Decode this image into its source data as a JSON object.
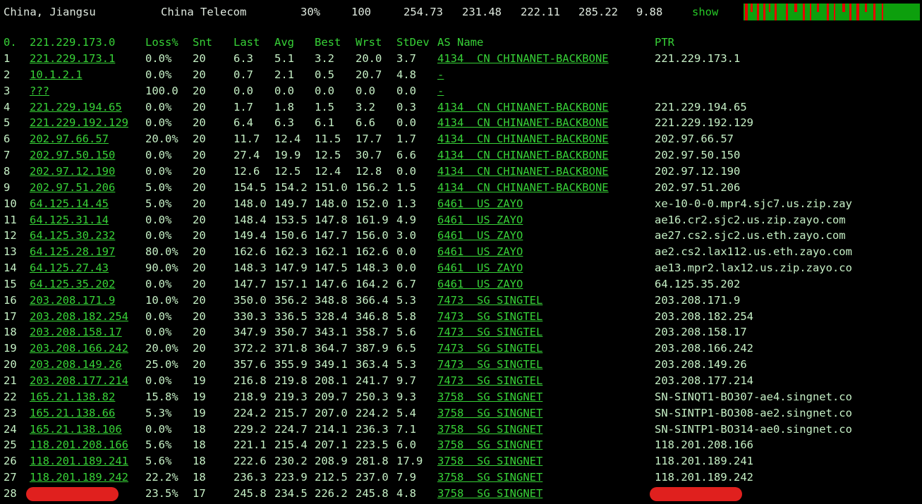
{
  "header": {
    "location": "China, Jiangsu",
    "isp": "China Telecom",
    "loss": "30%",
    "sent": "100",
    "v1": "254.73",
    "v2": "231.48",
    "v3": "222.11",
    "v4": "285.22",
    "v5": "9.88",
    "show_label": "show",
    "bar_colors": {
      "ok": "#0d9f0d",
      "loss": "#e60000"
    }
  },
  "columns": {
    "hop": "0.",
    "ip": "221.229.173.0",
    "loss": "Loss%",
    "snt": "Snt",
    "last": "Last",
    "avg": "Avg",
    "best": "Best",
    "wrst": "Wrst",
    "stdev": "StDev",
    "as": "AS Name",
    "ptr": "PTR"
  },
  "rows": [
    {
      "hop": "1",
      "ip": "221.229.173.1",
      "loss": "0.0%",
      "snt": "20",
      "last": "6.3",
      "avg": "5.1",
      "best": "3.2",
      "wrst": "20.0",
      "std": "3.7",
      "as": "4134  CN CHINANET-BACKBONE",
      "ptr": "221.229.173.1"
    },
    {
      "hop": "2",
      "ip": "10.1.2.1",
      "loss": "0.0%",
      "snt": "20",
      "last": "0.7",
      "avg": "2.1",
      "best": "0.5",
      "wrst": "20.7",
      "std": "4.8",
      "as": "-",
      "ptr": ""
    },
    {
      "hop": "3",
      "ip": "???",
      "loss": "100.0",
      "snt": "20",
      "last": "0.0",
      "avg": "0.0",
      "best": "0.0",
      "wrst": "0.0",
      "std": "0.0",
      "as": "-",
      "ptr": ""
    },
    {
      "hop": "4",
      "ip": "221.229.194.65",
      "loss": "0.0%",
      "snt": "20",
      "last": "1.7",
      "avg": "1.8",
      "best": "1.5",
      "wrst": "3.2",
      "std": "0.3",
      "as": "4134  CN CHINANET-BACKBONE",
      "ptr": "221.229.194.65"
    },
    {
      "hop": "5",
      "ip": "221.229.192.129",
      "loss": "0.0%",
      "snt": "20",
      "last": "6.4",
      "avg": "6.3",
      "best": "6.1",
      "wrst": "6.6",
      "std": "0.0",
      "as": "4134  CN CHINANET-BACKBONE",
      "ptr": "221.229.192.129"
    },
    {
      "hop": "6",
      "ip": "202.97.66.57",
      "loss": "20.0%",
      "snt": "20",
      "last": "11.7",
      "avg": "12.4",
      "best": "11.5",
      "wrst": "17.7",
      "std": "1.7",
      "as": "4134  CN CHINANET-BACKBONE",
      "ptr": "202.97.66.57"
    },
    {
      "hop": "7",
      "ip": "202.97.50.150",
      "loss": "0.0%",
      "snt": "20",
      "last": "27.4",
      "avg": "19.9",
      "best": "12.5",
      "wrst": "30.7",
      "std": "6.6",
      "as": "4134  CN CHINANET-BACKBONE",
      "ptr": "202.97.50.150"
    },
    {
      "hop": "8",
      "ip": "202.97.12.190",
      "loss": "0.0%",
      "snt": "20",
      "last": "12.6",
      "avg": "12.5",
      "best": "12.4",
      "wrst": "12.8",
      "std": "0.0",
      "as": "4134  CN CHINANET-BACKBONE",
      "ptr": "202.97.12.190"
    },
    {
      "hop": "9",
      "ip": "202.97.51.206",
      "loss": "5.0%",
      "snt": "20",
      "last": "154.5",
      "avg": "154.2",
      "best": "151.0",
      "wrst": "156.2",
      "std": "1.5",
      "as": "4134  CN CHINANET-BACKBONE",
      "ptr": "202.97.51.206"
    },
    {
      "hop": "10",
      "ip": "64.125.14.45",
      "loss": "5.0%",
      "snt": "20",
      "last": "148.0",
      "avg": "149.7",
      "best": "148.0",
      "wrst": "152.0",
      "std": "1.3",
      "as": "6461  US ZAYO",
      "ptr": "xe-10-0-0.mpr4.sjc7.us.zip.zay"
    },
    {
      "hop": "11",
      "ip": "64.125.31.14",
      "loss": "0.0%",
      "snt": "20",
      "last": "148.4",
      "avg": "153.5",
      "best": "147.8",
      "wrst": "161.9",
      "std": "4.9",
      "as": "6461  US ZAYO",
      "ptr": "ae16.cr2.sjc2.us.zip.zayo.com"
    },
    {
      "hop": "12",
      "ip": "64.125.30.232",
      "loss": "0.0%",
      "snt": "20",
      "last": "149.4",
      "avg": "150.6",
      "best": "147.7",
      "wrst": "156.0",
      "std": "3.0",
      "as": "6461  US ZAYO",
      "ptr": "ae27.cs2.sjc2.us.eth.zayo.com"
    },
    {
      "hop": "13",
      "ip": "64.125.28.197",
      "loss": "80.0%",
      "snt": "20",
      "last": "162.6",
      "avg": "162.3",
      "best": "162.1",
      "wrst": "162.6",
      "std": "0.0",
      "as": "6461  US ZAYO",
      "ptr": "ae2.cs2.lax112.us.eth.zayo.com"
    },
    {
      "hop": "14",
      "ip": "64.125.27.43",
      "loss": "90.0%",
      "snt": "20",
      "last": "148.3",
      "avg": "147.9",
      "best": "147.5",
      "wrst": "148.3",
      "std": "0.0",
      "as": "6461  US ZAYO",
      "ptr": "ae13.mpr2.lax12.us.zip.zayo.co"
    },
    {
      "hop": "15",
      "ip": "64.125.35.202",
      "loss": "0.0%",
      "snt": "20",
      "last": "147.7",
      "avg": "157.1",
      "best": "147.6",
      "wrst": "164.2",
      "std": "6.7",
      "as": "6461  US ZAYO",
      "ptr": "64.125.35.202"
    },
    {
      "hop": "16",
      "ip": "203.208.171.9",
      "loss": "10.0%",
      "snt": "20",
      "last": "350.0",
      "avg": "356.2",
      "best": "348.8",
      "wrst": "366.4",
      "std": "5.3",
      "as": "7473  SG SINGTEL",
      "ptr": "203.208.171.9"
    },
    {
      "hop": "17",
      "ip": "203.208.182.254",
      "loss": "0.0%",
      "snt": "20",
      "last": "330.3",
      "avg": "336.5",
      "best": "328.4",
      "wrst": "346.8",
      "std": "5.8",
      "as": "7473  SG SINGTEL",
      "ptr": "203.208.182.254"
    },
    {
      "hop": "18",
      "ip": "203.208.158.17",
      "loss": "0.0%",
      "snt": "20",
      "last": "347.9",
      "avg": "350.7",
      "best": "343.1",
      "wrst": "358.7",
      "std": "5.6",
      "as": "7473  SG SINGTEL",
      "ptr": "203.208.158.17"
    },
    {
      "hop": "19",
      "ip": "203.208.166.242",
      "loss": "20.0%",
      "snt": "20",
      "last": "372.2",
      "avg": "371.8",
      "best": "364.7",
      "wrst": "387.9",
      "std": "6.5",
      "as": "7473  SG SINGTEL",
      "ptr": "203.208.166.242"
    },
    {
      "hop": "20",
      "ip": "203.208.149.26",
      "loss": "25.0%",
      "snt": "20",
      "last": "357.6",
      "avg": "355.9",
      "best": "349.1",
      "wrst": "363.4",
      "std": "5.3",
      "as": "7473  SG SINGTEL",
      "ptr": "203.208.149.26"
    },
    {
      "hop": "21",
      "ip": "203.208.177.214",
      "loss": "0.0%",
      "snt": "19",
      "last": "216.8",
      "avg": "219.8",
      "best": "208.1",
      "wrst": "241.7",
      "std": "9.7",
      "as": "7473  SG SINGTEL",
      "ptr": "203.208.177.214"
    },
    {
      "hop": "22",
      "ip": "165.21.138.82",
      "loss": "15.8%",
      "snt": "19",
      "last": "218.9",
      "avg": "219.3",
      "best": "209.7",
      "wrst": "250.3",
      "std": "9.3",
      "as": "3758  SG SINGNET",
      "ptr": "SN-SINQT1-BO307-ae4.singnet.co"
    },
    {
      "hop": "23",
      "ip": "165.21.138.66",
      "loss": "5.3%",
      "snt": "19",
      "last": "224.2",
      "avg": "215.7",
      "best": "207.0",
      "wrst": "224.2",
      "std": "5.4",
      "as": "3758  SG SINGNET",
      "ptr": "SN-SINTP1-BO308-ae2.singnet.co"
    },
    {
      "hop": "24",
      "ip": "165.21.138.106",
      "loss": "0.0%",
      "snt": "18",
      "last": "229.2",
      "avg": "224.7",
      "best": "214.1",
      "wrst": "236.3",
      "std": "7.1",
      "as": "3758  SG SINGNET",
      "ptr": "SN-SINTP1-BO314-ae0.singnet.co"
    },
    {
      "hop": "25",
      "ip": "118.201.208.166",
      "loss": "5.6%",
      "snt": "18",
      "last": "221.1",
      "avg": "215.4",
      "best": "207.1",
      "wrst": "223.5",
      "std": "6.0",
      "as": "3758  SG SINGNET",
      "ptr": "118.201.208.166"
    },
    {
      "hop": "26",
      "ip": "118.201.189.241",
      "loss": "5.6%",
      "snt": "18",
      "last": "222.6",
      "avg": "230.2",
      "best": "208.9",
      "wrst": "281.8",
      "std": "17.9",
      "as": "3758  SG SINGNET",
      "ptr": "118.201.189.241"
    },
    {
      "hop": "27",
      "ip": "118.201.189.242",
      "loss": "22.2%",
      "snt": "18",
      "last": "236.3",
      "avg": "223.9",
      "best": "212.5",
      "wrst": "237.0",
      "std": "7.9",
      "as": "3758  SG SINGNET",
      "ptr": "118.201.189.242"
    },
    {
      "hop": "28",
      "ip": "",
      "loss": "23.5%",
      "snt": "17",
      "last": "245.8",
      "avg": "234.5",
      "best": "226.2",
      "wrst": "245.8",
      "std": "4.8",
      "as": "3758  SG SINGNET",
      "ptr": "",
      "redacted": true
    }
  ]
}
